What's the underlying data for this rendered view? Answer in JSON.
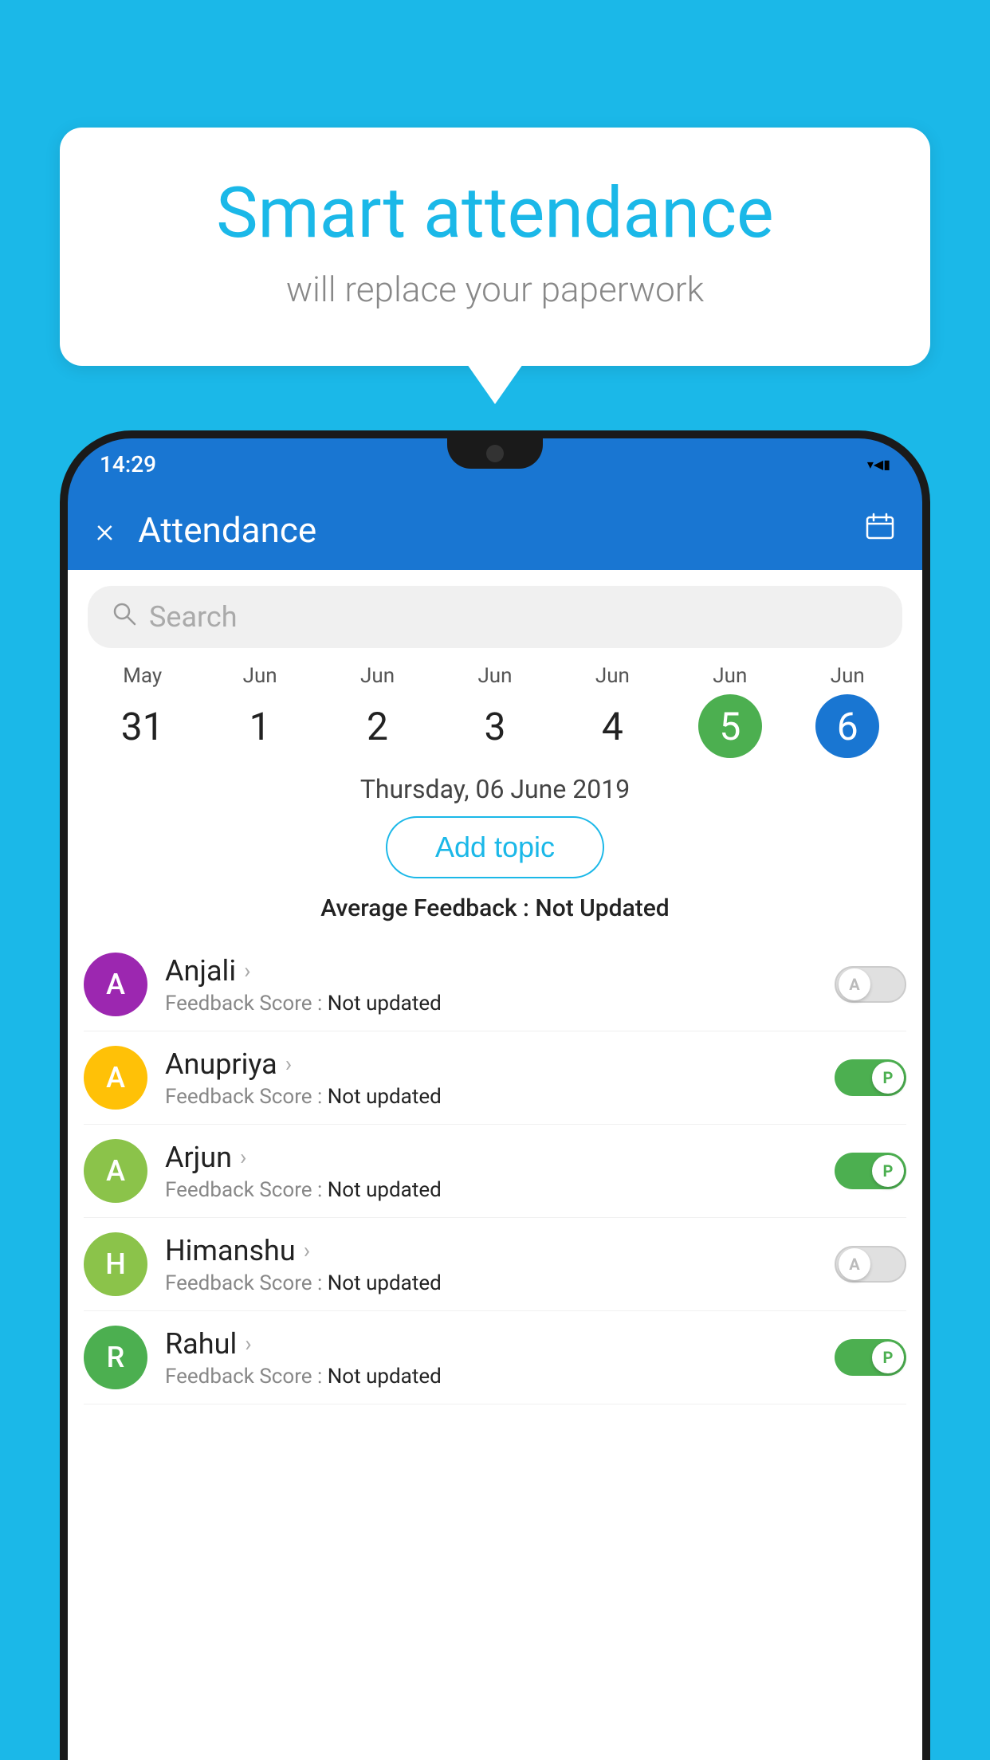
{
  "background_color": "#1BB8E8",
  "speech_bubble": {
    "title": "Smart attendance",
    "subtitle": "will replace your paperwork"
  },
  "status_bar": {
    "time": "14:29",
    "icons": [
      "wifi",
      "signal",
      "battery"
    ]
  },
  "app_header": {
    "title": "Attendance",
    "close_label": "×"
  },
  "search": {
    "placeholder": "Search"
  },
  "dates": [
    {
      "month": "May",
      "day": "31",
      "selected": false
    },
    {
      "month": "Jun",
      "day": "1",
      "selected": false
    },
    {
      "month": "Jun",
      "day": "2",
      "selected": false
    },
    {
      "month": "Jun",
      "day": "3",
      "selected": false
    },
    {
      "month": "Jun",
      "day": "4",
      "selected": false
    },
    {
      "month": "Jun",
      "day": "5",
      "selected": "green"
    },
    {
      "month": "Jun",
      "day": "6",
      "selected": "blue"
    }
  ],
  "selected_date_display": "Thursday, 06 June 2019",
  "add_topic_label": "Add topic",
  "avg_feedback_label": "Average Feedback : ",
  "avg_feedback_value": "Not Updated",
  "students": [
    {
      "name": "Anjali",
      "avatar_letter": "A",
      "avatar_color": "#9C27B0",
      "feedback_label": "Feedback Score : ",
      "feedback_value": "Not updated",
      "toggle": "off",
      "toggle_letter": "A"
    },
    {
      "name": "Anupriya",
      "avatar_letter": "A",
      "avatar_color": "#FFC107",
      "feedback_label": "Feedback Score : ",
      "feedback_value": "Not updated",
      "toggle": "on",
      "toggle_letter": "P"
    },
    {
      "name": "Arjun",
      "avatar_letter": "A",
      "avatar_color": "#8BC34A",
      "feedback_label": "Feedback Score : ",
      "feedback_value": "Not updated",
      "toggle": "on",
      "toggle_letter": "P"
    },
    {
      "name": "Himanshu",
      "avatar_letter": "H",
      "avatar_color": "#8BC34A",
      "feedback_label": "Feedback Score : ",
      "feedback_value": "Not updated",
      "toggle": "off",
      "toggle_letter": "A"
    },
    {
      "name": "Rahul",
      "avatar_letter": "R",
      "avatar_color": "#4CAF50",
      "feedback_label": "Feedback Score : ",
      "feedback_value": "Not updated",
      "toggle": "on",
      "toggle_letter": "P"
    }
  ]
}
